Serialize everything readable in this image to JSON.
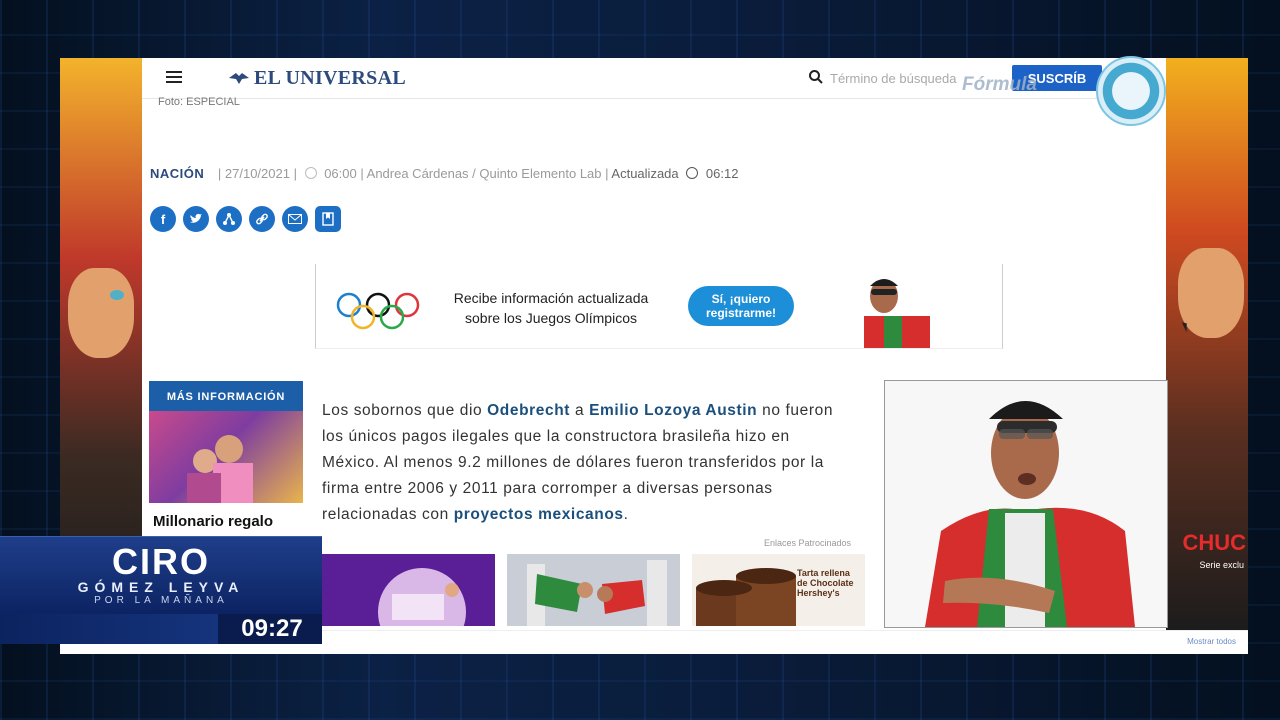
{
  "header": {
    "logo_text": "EL UNIVERSAL",
    "search_placeholder": "Término de búsqueda",
    "subscribe_label": "SUSCRÍB"
  },
  "article": {
    "photo_credit": "Foto: ESPECIAL",
    "section": "NACIÓN",
    "date": "| 27/10/2021 |",
    "time": "06:00",
    "authors": "| Andrea Cárdenas / Quinto Elemento Lab |",
    "updated_label": "Actualizada",
    "updated_time": "06:12",
    "body": {
      "p1": "Los sobornos que dio ",
      "link1": "Odebrecht",
      "p2": " a ",
      "link2": "Emilio Lozoya Austin",
      "p3": " no fueron los únicos pagos ilegales que la constructora brasileña hizo en México. Al menos 9.2 millones de dólares fueron transferidos por la firma entre 2006 y 2011 para corromper a diversas personas relacionadas con ",
      "link3": "proyectos mexicanos",
      "p4": "."
    }
  },
  "share": [
    "facebook-icon",
    "twitter-icon",
    "share-icon",
    "link-icon",
    "email-icon",
    "bookmark-icon"
  ],
  "banner": {
    "text": "Recibe información actualizada sobre los Juegos Olímpicos",
    "button_label": "Sí, ¡quiero registrarme!"
  },
  "more_info": {
    "heading": "MÁS INFORMACIÓN",
    "title": "Millonario regalo"
  },
  "sponsored": {
    "label": "Enlaces Patrocinados",
    "item3_caption": "Tarta rellena de Chocolate Hershey's"
  },
  "side_ad": {
    "right_text": "CHUC",
    "right_sub": "Serie exclu"
  },
  "footer": {
    "right_link": "Mostrar todos"
  },
  "overlay": {
    "formula_text": "Fórmula",
    "show_name": "CIRO",
    "show_sub": "GÓMEZ LEYVA",
    "show_sub2": "POR LA MAÑANA",
    "clock": "09:27"
  },
  "colors": {
    "brand_blue": "#2c4a7c",
    "share_blue": "#1d6fc4",
    "subscribe_blue": "#1d62c7"
  }
}
